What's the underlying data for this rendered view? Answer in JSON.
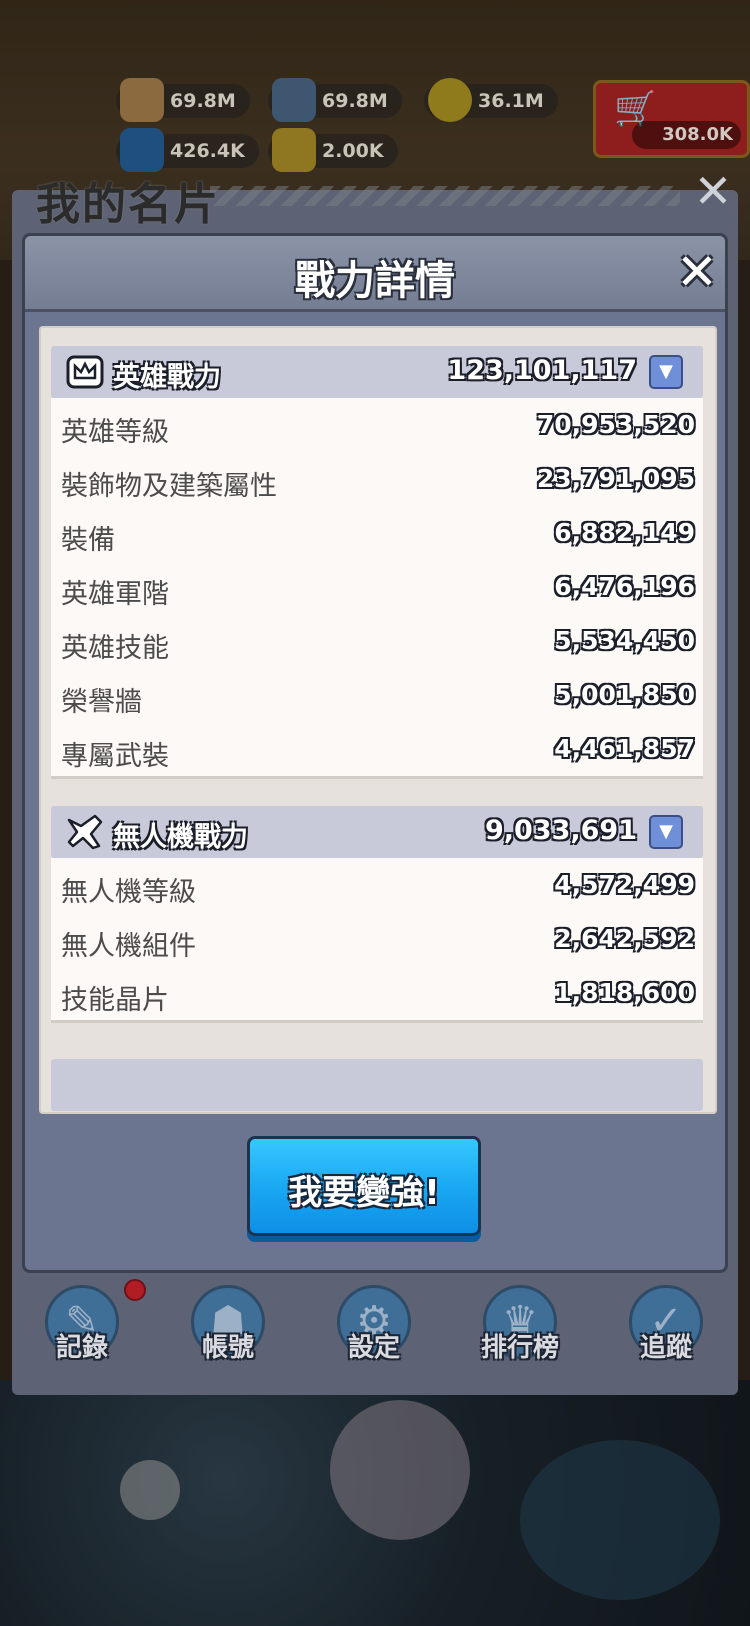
{
  "resources": {
    "bread": "69.8M",
    "iron": "69.8M",
    "gold": "36.1M",
    "oil": "426.4K",
    "ticket": "2.00K",
    "gems": "308.0K"
  },
  "profile_card": {
    "title": "我的名片",
    "nav": [
      {
        "label": "記錄"
      },
      {
        "label": "帳號"
      },
      {
        "label": "設定"
      },
      {
        "label": "排行榜"
      },
      {
        "label": "追蹤"
      }
    ]
  },
  "modal": {
    "title": "戰力詳情",
    "cta_label": "我要變強!",
    "sections": [
      {
        "title": "英雄戰力",
        "total": "123,101,117",
        "rows": [
          {
            "label": "英雄等級",
            "value": "70,953,520"
          },
          {
            "label": "裝飾物及建築屬性",
            "value": "23,791,095"
          },
          {
            "label": "裝備",
            "value": "6,882,149"
          },
          {
            "label": "英雄軍階",
            "value": "6,476,196"
          },
          {
            "label": "英雄技能",
            "value": "5,534,450"
          },
          {
            "label": "榮譽牆",
            "value": "5,001,850"
          },
          {
            "label": "專屬武裝",
            "value": "4,461,857"
          }
        ]
      },
      {
        "title": "無人機戰力",
        "total": "9,033,691",
        "rows": [
          {
            "label": "無人機等級",
            "value": "4,572,499"
          },
          {
            "label": "無人機組件",
            "value": "2,642,592"
          },
          {
            "label": "技能晶片",
            "value": "1,818,600"
          }
        ]
      }
    ]
  },
  "colors": {
    "cta_blue": "#1aa9f3",
    "dropdown_blue": "#6f8fd8",
    "notification_red": "#b21d24"
  }
}
